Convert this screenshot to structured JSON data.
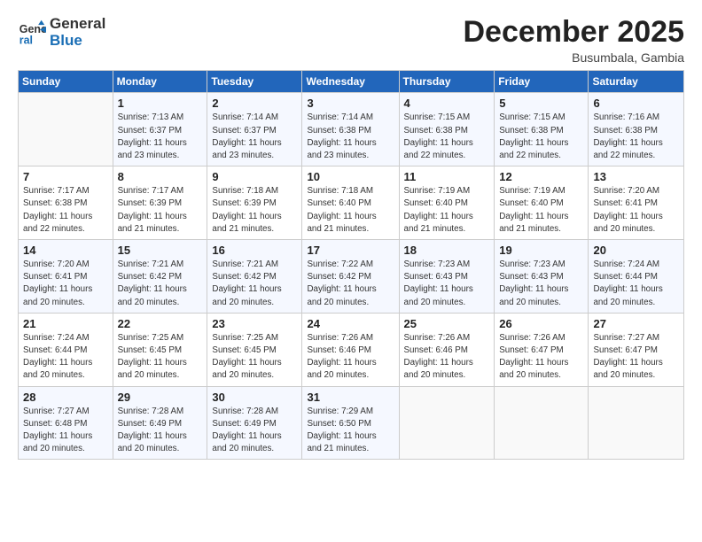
{
  "logo": {
    "line1": "General",
    "line2": "Blue"
  },
  "title": "December 2025",
  "subtitle": "Busumbala, Gambia",
  "header": {
    "days": [
      "Sunday",
      "Monday",
      "Tuesday",
      "Wednesday",
      "Thursday",
      "Friday",
      "Saturday"
    ]
  },
  "weeks": [
    [
      {
        "day": "",
        "info": ""
      },
      {
        "day": "1",
        "info": "Sunrise: 7:13 AM\nSunset: 6:37 PM\nDaylight: 11 hours\nand 23 minutes."
      },
      {
        "day": "2",
        "info": "Sunrise: 7:14 AM\nSunset: 6:37 PM\nDaylight: 11 hours\nand 23 minutes."
      },
      {
        "day": "3",
        "info": "Sunrise: 7:14 AM\nSunset: 6:38 PM\nDaylight: 11 hours\nand 23 minutes."
      },
      {
        "day": "4",
        "info": "Sunrise: 7:15 AM\nSunset: 6:38 PM\nDaylight: 11 hours\nand 22 minutes."
      },
      {
        "day": "5",
        "info": "Sunrise: 7:15 AM\nSunset: 6:38 PM\nDaylight: 11 hours\nand 22 minutes."
      },
      {
        "day": "6",
        "info": "Sunrise: 7:16 AM\nSunset: 6:38 PM\nDaylight: 11 hours\nand 22 minutes."
      }
    ],
    [
      {
        "day": "7",
        "info": "Sunrise: 7:17 AM\nSunset: 6:38 PM\nDaylight: 11 hours\nand 22 minutes."
      },
      {
        "day": "8",
        "info": "Sunrise: 7:17 AM\nSunset: 6:39 PM\nDaylight: 11 hours\nand 21 minutes."
      },
      {
        "day": "9",
        "info": "Sunrise: 7:18 AM\nSunset: 6:39 PM\nDaylight: 11 hours\nand 21 minutes."
      },
      {
        "day": "10",
        "info": "Sunrise: 7:18 AM\nSunset: 6:40 PM\nDaylight: 11 hours\nand 21 minutes."
      },
      {
        "day": "11",
        "info": "Sunrise: 7:19 AM\nSunset: 6:40 PM\nDaylight: 11 hours\nand 21 minutes."
      },
      {
        "day": "12",
        "info": "Sunrise: 7:19 AM\nSunset: 6:40 PM\nDaylight: 11 hours\nand 21 minutes."
      },
      {
        "day": "13",
        "info": "Sunrise: 7:20 AM\nSunset: 6:41 PM\nDaylight: 11 hours\nand 20 minutes."
      }
    ],
    [
      {
        "day": "14",
        "info": "Sunrise: 7:20 AM\nSunset: 6:41 PM\nDaylight: 11 hours\nand 20 minutes."
      },
      {
        "day": "15",
        "info": "Sunrise: 7:21 AM\nSunset: 6:42 PM\nDaylight: 11 hours\nand 20 minutes."
      },
      {
        "day": "16",
        "info": "Sunrise: 7:21 AM\nSunset: 6:42 PM\nDaylight: 11 hours\nand 20 minutes."
      },
      {
        "day": "17",
        "info": "Sunrise: 7:22 AM\nSunset: 6:42 PM\nDaylight: 11 hours\nand 20 minutes."
      },
      {
        "day": "18",
        "info": "Sunrise: 7:23 AM\nSunset: 6:43 PM\nDaylight: 11 hours\nand 20 minutes."
      },
      {
        "day": "19",
        "info": "Sunrise: 7:23 AM\nSunset: 6:43 PM\nDaylight: 11 hours\nand 20 minutes."
      },
      {
        "day": "20",
        "info": "Sunrise: 7:24 AM\nSunset: 6:44 PM\nDaylight: 11 hours\nand 20 minutes."
      }
    ],
    [
      {
        "day": "21",
        "info": "Sunrise: 7:24 AM\nSunset: 6:44 PM\nDaylight: 11 hours\nand 20 minutes."
      },
      {
        "day": "22",
        "info": "Sunrise: 7:25 AM\nSunset: 6:45 PM\nDaylight: 11 hours\nand 20 minutes."
      },
      {
        "day": "23",
        "info": "Sunrise: 7:25 AM\nSunset: 6:45 PM\nDaylight: 11 hours\nand 20 minutes."
      },
      {
        "day": "24",
        "info": "Sunrise: 7:26 AM\nSunset: 6:46 PM\nDaylight: 11 hours\nand 20 minutes."
      },
      {
        "day": "25",
        "info": "Sunrise: 7:26 AM\nSunset: 6:46 PM\nDaylight: 11 hours\nand 20 minutes."
      },
      {
        "day": "26",
        "info": "Sunrise: 7:26 AM\nSunset: 6:47 PM\nDaylight: 11 hours\nand 20 minutes."
      },
      {
        "day": "27",
        "info": "Sunrise: 7:27 AM\nSunset: 6:47 PM\nDaylight: 11 hours\nand 20 minutes."
      }
    ],
    [
      {
        "day": "28",
        "info": "Sunrise: 7:27 AM\nSunset: 6:48 PM\nDaylight: 11 hours\nand 20 minutes."
      },
      {
        "day": "29",
        "info": "Sunrise: 7:28 AM\nSunset: 6:49 PM\nDaylight: 11 hours\nand 20 minutes."
      },
      {
        "day": "30",
        "info": "Sunrise: 7:28 AM\nSunset: 6:49 PM\nDaylight: 11 hours\nand 20 minutes."
      },
      {
        "day": "31",
        "info": "Sunrise: 7:29 AM\nSunset: 6:50 PM\nDaylight: 11 hours\nand 21 minutes."
      },
      {
        "day": "",
        "info": ""
      },
      {
        "day": "",
        "info": ""
      },
      {
        "day": "",
        "info": ""
      }
    ]
  ]
}
